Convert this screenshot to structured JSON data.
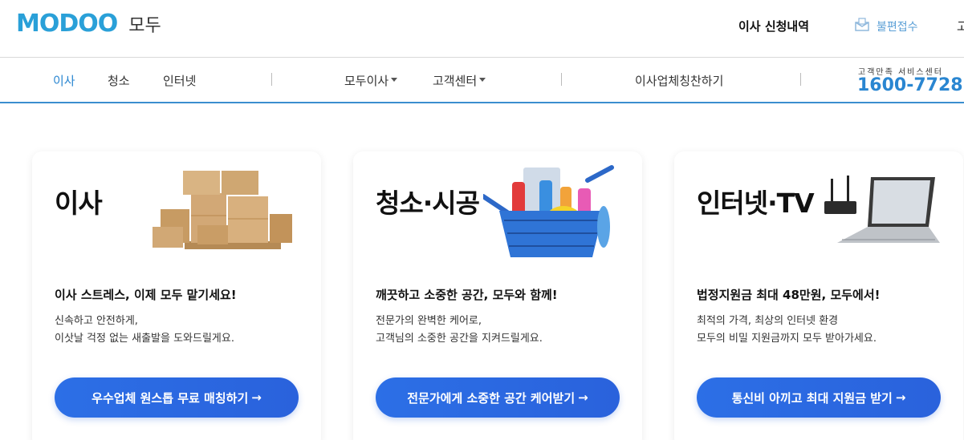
{
  "header": {
    "logo_text": "MODOO",
    "logo_sub": "모두",
    "apply_history": "이사 신청내역",
    "complaint": "불편접수",
    "edge_text": "고"
  },
  "nav": {
    "items": [
      {
        "label": "이사",
        "active": true
      },
      {
        "label": "청소",
        "active": false
      },
      {
        "label": "인터넷",
        "active": false
      },
      {
        "label": "모두이사",
        "dropdown": true
      },
      {
        "label": "고객센터",
        "dropdown": true
      },
      {
        "label": "이사업체칭찬하기"
      }
    ],
    "service_label": "고객만족 서비스센터",
    "service_phone": "1600-7728"
  },
  "cards": [
    {
      "title": "이사",
      "headline": "이사 스트레스, 이제 모두 맡기세요!",
      "desc1": "신속하고 안전하게,",
      "desc2": "이삿날 걱정 없는 새출발을 도와드릴게요.",
      "button": "우수업체 원스톱 무료 매칭하기",
      "icon": "boxes-illustration"
    },
    {
      "title": "청소·시공",
      "headline": "깨끗하고 소중한 공간, 모두와 함께!",
      "desc1": "전문가의 완벽한 케어로,",
      "desc2": "고객님의 소중한 공간을 지켜드릴게요.",
      "button": "전문가에게 소중한 공간 케어받기",
      "icon": "cleaning-basket-illustration"
    },
    {
      "title": "인터넷·TV",
      "headline": "법정지원금 최대 48만원, 모두에서!",
      "desc1": "최적의 가격, 최상의 인터넷 환경",
      "desc2": "모두의 비밀 지원금까지 모두 받아가세요.",
      "button": "통신비 아끼고 최대 지원금 받기",
      "icon": "router-laptop-illustration"
    }
  ],
  "arrow": "→",
  "colors": {
    "accent": "#2a86d1",
    "button": "#2c6fe6",
    "logo": "#2aa0d8"
  }
}
